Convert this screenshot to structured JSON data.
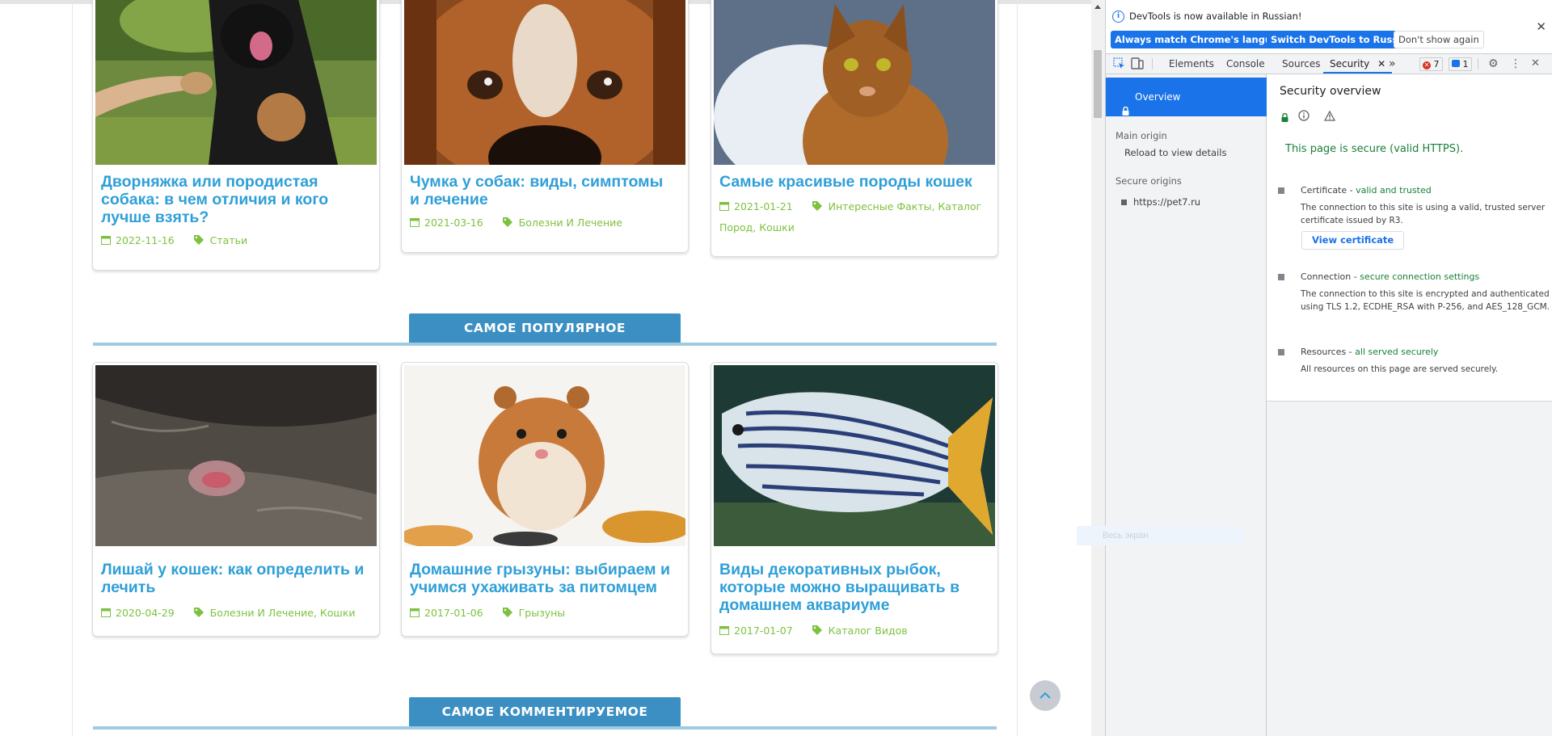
{
  "site": {
    "row1": [
      {
        "title": "Дворняжка или породистая собака: в чем отличия и кого лучше взять?",
        "date": "2022-11-16",
        "tags": "Статьи"
      },
      {
        "title": "Чумка у собак: виды, симптомы и лечение",
        "date": "2021-03-16",
        "tags": "Болезни И Лечение"
      },
      {
        "title": "Самые красивые породы кошек",
        "date": "2021-01-21",
        "tags": "Интересные Факты, Каталог Пород, Кошки"
      }
    ],
    "popular_heading": "САМОЕ ПОПУЛЯРНОЕ",
    "row2": [
      {
        "title": "Лишай у кошек: как определить и лечить",
        "date": "2020-04-29",
        "tags": "Болезни И Лечение, Кошки"
      },
      {
        "title": "Домашние грызуны: выбираем и учимся ухаживать за питомцем",
        "date": "2017-01-06",
        "tags": "Грызуны"
      },
      {
        "title": "Виды декоративных рыбок, которые можно выращивать в домашнем аквариуме",
        "date": "2017-01-07",
        "tags": "Каталог Видов"
      }
    ],
    "commented_heading": "САМОЕ КОММЕНТИРУЕМОЕ",
    "colors": {
      "title": "#2f9fd8",
      "meta": "#7cc23f",
      "section": "#3b8fc2"
    }
  },
  "devtools": {
    "infobar": {
      "message": "DevTools is now available in Russian!",
      "btn_match": "Always match Chrome's language",
      "btn_switch": "Switch DevTools to Russian",
      "btn_dont": "Don't show again"
    },
    "tabs": {
      "elements": "Elements",
      "console": "Console",
      "sources": "Sources",
      "security": "Security"
    },
    "errors": "7",
    "messages": "1",
    "sidebar": {
      "overview": "Overview",
      "main_origin": "Main origin",
      "reload": "Reload to view details",
      "secure_origins": "Secure origins",
      "origin": "https://pet7.ru"
    },
    "panel": {
      "title": "Security overview",
      "secure": "This page is secure (valid HTTPS).",
      "cert_label": "Certificate - ",
      "cert_status": "valid and trusted",
      "cert_desc": "The connection to this site is using a valid, trusted server certificate issued by R3.",
      "view_cert": "View certificate",
      "conn_label": "Connection - ",
      "conn_status": "secure connection settings",
      "conn_desc": "The connection to this site is encrypted and authenticated using TLS 1.2, ECDHE_RSA with P-256, and AES_128_GCM.",
      "res_label": "Resources - ",
      "res_status": "all served securely",
      "res_desc": "All resources on this page are served securely."
    },
    "ghost_text": "Весь экран"
  }
}
